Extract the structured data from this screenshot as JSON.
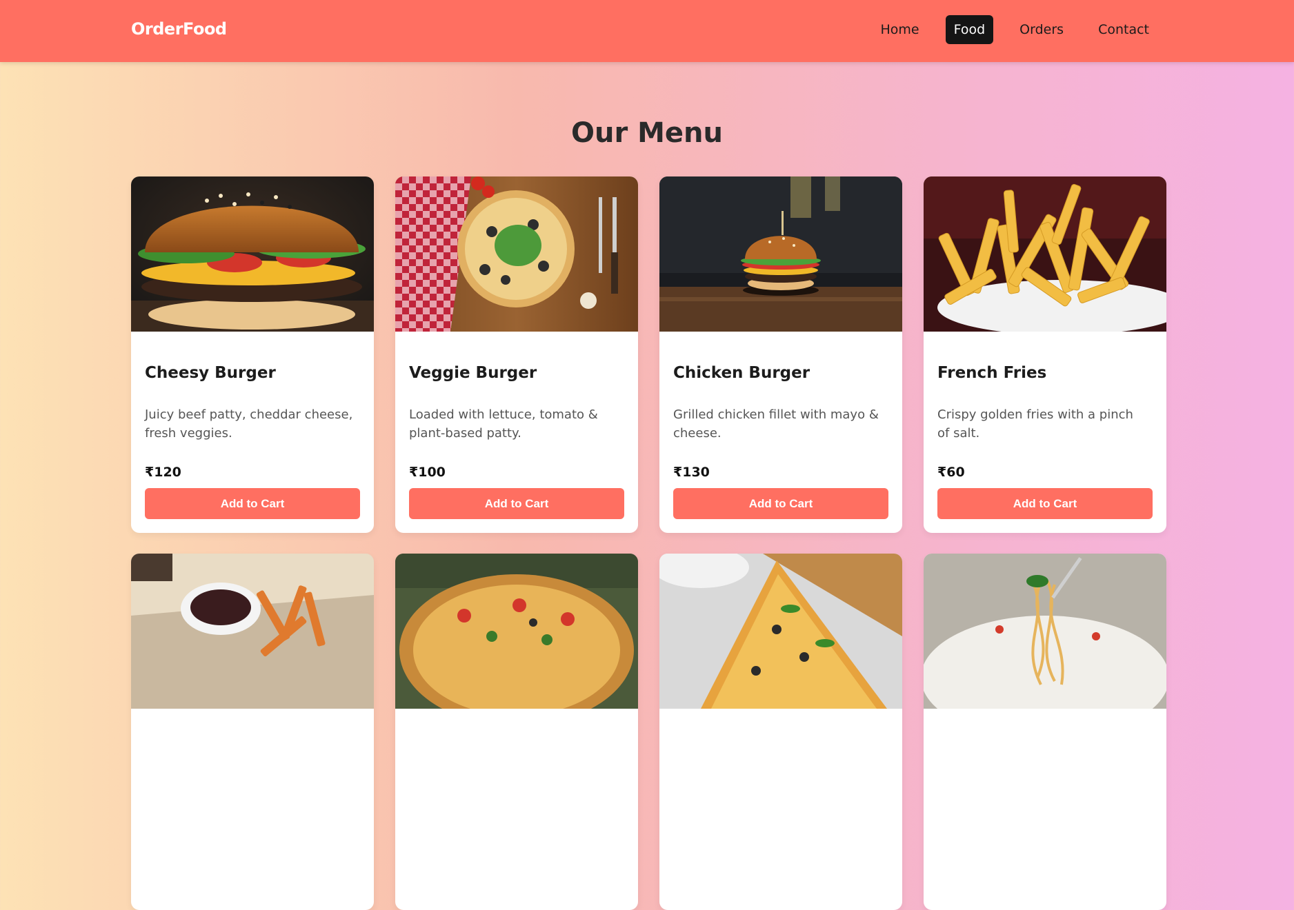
{
  "brand": "OrderFood",
  "nav": {
    "items": [
      {
        "label": "Home",
        "active": false
      },
      {
        "label": "Food",
        "active": true
      },
      {
        "label": "Orders",
        "active": false
      },
      {
        "label": "Contact",
        "active": false
      }
    ]
  },
  "menu": {
    "title": "Our Menu",
    "add_to_cart_label": "Add to Cart",
    "items": [
      {
        "name": "Cheesy Burger",
        "description": "Juicy beef patty, cheddar cheese, fresh veggies.",
        "price": "₹120",
        "image": "cheesy-burger-photo"
      },
      {
        "name": "Veggie Burger",
        "description": "Loaded with lettuce, tomato & plant-based patty.",
        "price": "₹100",
        "image": "pizza-on-wooden-board-photo"
      },
      {
        "name": "Chicken Burger",
        "description": "Grilled chicken fillet with mayo & cheese.",
        "price": "₹130",
        "image": "chicken-burger-photo"
      },
      {
        "name": "French Fries",
        "description": "Crispy golden fries with a pinch of salt.",
        "price": "₹60",
        "image": "french-fries-photo"
      }
    ],
    "partial_items": [
      {
        "image": "sweet-potato-fries-with-dip-photo"
      },
      {
        "image": "vegetable-pizza-photo"
      },
      {
        "image": "pizza-slices-photo"
      },
      {
        "image": "spaghetti-photo"
      }
    ]
  },
  "colors": {
    "navbar": "#ff6f61",
    "button": "#ff6f61",
    "active_nav": "#151515"
  }
}
